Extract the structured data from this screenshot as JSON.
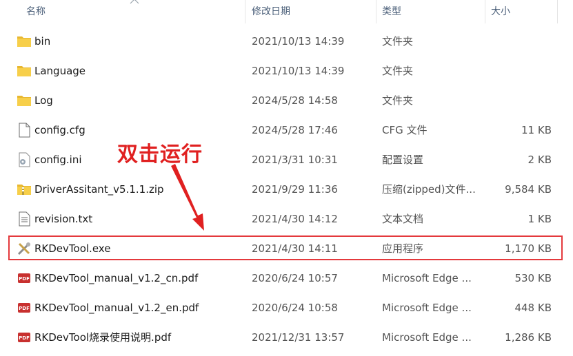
{
  "columns": {
    "name": "名称",
    "modified": "修改日期",
    "type": "类型",
    "size": "大小"
  },
  "rows": [
    {
      "name": "bin",
      "modified": "2021/10/13 14:39",
      "type": "文件夹",
      "size": "",
      "icon": "folder-icon"
    },
    {
      "name": "Language",
      "modified": "2021/10/13 14:39",
      "type": "文件夹",
      "size": "",
      "icon": "folder-icon"
    },
    {
      "name": "Log",
      "modified": "2024/5/28 14:58",
      "type": "文件夹",
      "size": "",
      "icon": "folder-icon"
    },
    {
      "name": "config.cfg",
      "modified": "2024/5/28 17:46",
      "type": "CFG 文件",
      "size": "11 KB",
      "icon": "blank-file-icon"
    },
    {
      "name": "config.ini",
      "modified": "2021/3/31 10:31",
      "type": "配置设置",
      "size": "2 KB",
      "icon": "settings-file-icon"
    },
    {
      "name": "DriverAssitant_v5.1.1.zip",
      "modified": "2021/9/29 11:36",
      "type": "压缩(zipped)文件...",
      "size": "9,584 KB",
      "icon": "zip-folder-icon"
    },
    {
      "name": "revision.txt",
      "modified": "2021/4/30 14:12",
      "type": "文本文档",
      "size": "1 KB",
      "icon": "text-file-icon"
    },
    {
      "name": "RKDevTool.exe",
      "modified": "2021/4/30 14:11",
      "type": "应用程序",
      "size": "1,170 KB",
      "icon": "tools-app-icon"
    },
    {
      "name": "RKDevTool_manual_v1.2_cn.pdf",
      "modified": "2020/6/24 10:57",
      "type": "Microsoft Edge ...",
      "size": "530 KB",
      "icon": "pdf-icon"
    },
    {
      "name": "RKDevTool_manual_v1.2_en.pdf",
      "modified": "2020/6/24 10:58",
      "type": "Microsoft Edge ...",
      "size": "448 KB",
      "icon": "pdf-icon"
    },
    {
      "name": "RKDevTool烧录使用说明.pdf",
      "modified": "2021/12/31 13:57",
      "type": "Microsoft Edge ...",
      "size": "1,286 KB",
      "icon": "pdf-icon"
    }
  ],
  "annotation": {
    "text": "双击运行"
  },
  "colors": {
    "annotation": "#e02020",
    "folder": "#f4c542",
    "pdf": "#c8302f"
  }
}
